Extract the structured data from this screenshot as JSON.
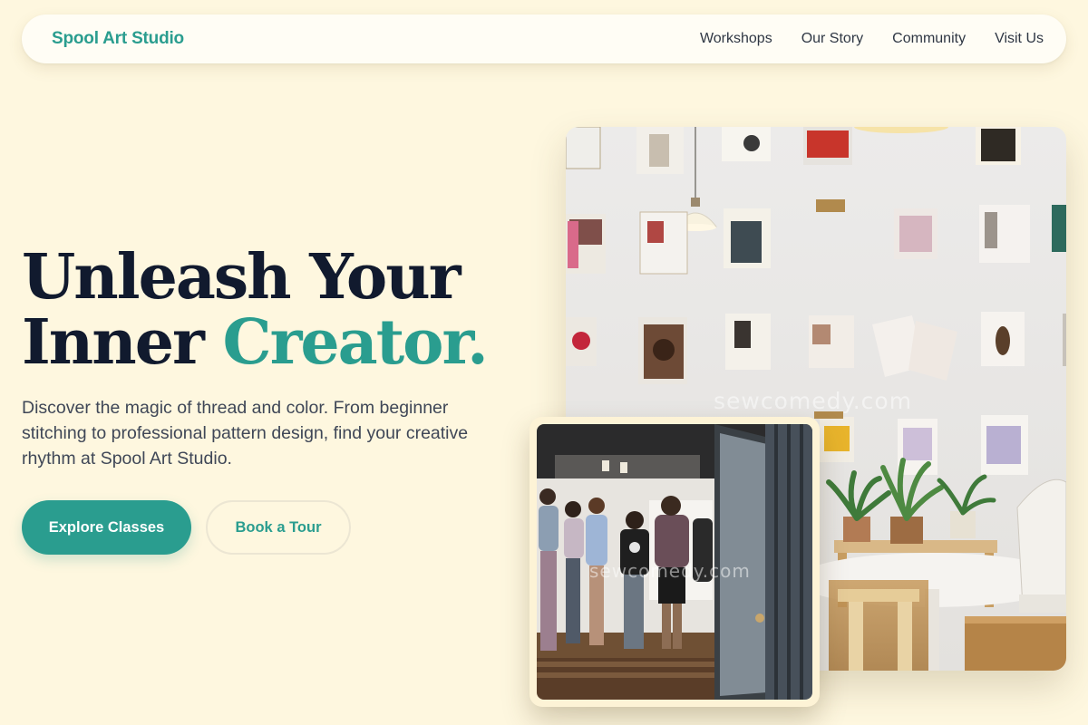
{
  "brand": {
    "name": "Spool Art Studio",
    "accent_color": "#2a9d8f"
  },
  "nav": {
    "links": [
      "Workshops",
      "Our Story",
      "Community",
      "Visit Us"
    ]
  },
  "hero": {
    "title_line1": "Unleash Your",
    "title_line2_plain": "Inner ",
    "title_line2_accent": "Creator.",
    "description": "Discover the magic of thread and color. From beginner stitching to professional pattern design, find your creative rhythm at Spool Art Studio.",
    "primary_cta": "Explore Classes",
    "secondary_cta": "Book a Tour"
  },
  "images": {
    "main_alt": "Bright studio wall with clipboards holding magazines, a pendant lamp and plants",
    "secondary_alt": "Visitors standing in a gallery seen through an open door",
    "watermark": "sewcomedy.com"
  },
  "colors": {
    "background": "#fef7df",
    "heading": "#111a2e",
    "body_text": "#3f4757"
  }
}
